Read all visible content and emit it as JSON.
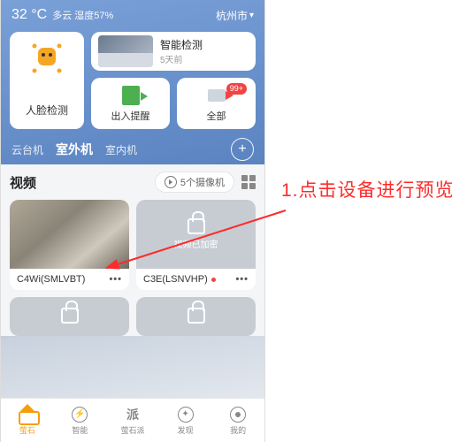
{
  "top": {
    "temp": "32 °C",
    "weather": "多云 湿度57%",
    "city": "杭州市"
  },
  "cards": {
    "face_label": "人脸检测",
    "ai_title": "智能检测",
    "ai_sub": "5天前",
    "entry_label": "出入提醒",
    "all_label": "全部",
    "all_badge": "99+"
  },
  "tabs": {
    "t1": "云台机",
    "t2": "室外机",
    "t3": "室内机"
  },
  "section": {
    "title": "视频",
    "cam_count": "5个摄像机"
  },
  "cams": {
    "c1_name": "C4Wi(SMLVBT)",
    "c2_name": "C3E(LSNVHP)",
    "enc_text": "视频已加密"
  },
  "nav": {
    "n1": "萤石",
    "n2": "智能",
    "n3": "萤石派",
    "n4": "发现",
    "n5": "我的"
  },
  "annotation": {
    "text": "1.点击设备进行预览"
  }
}
